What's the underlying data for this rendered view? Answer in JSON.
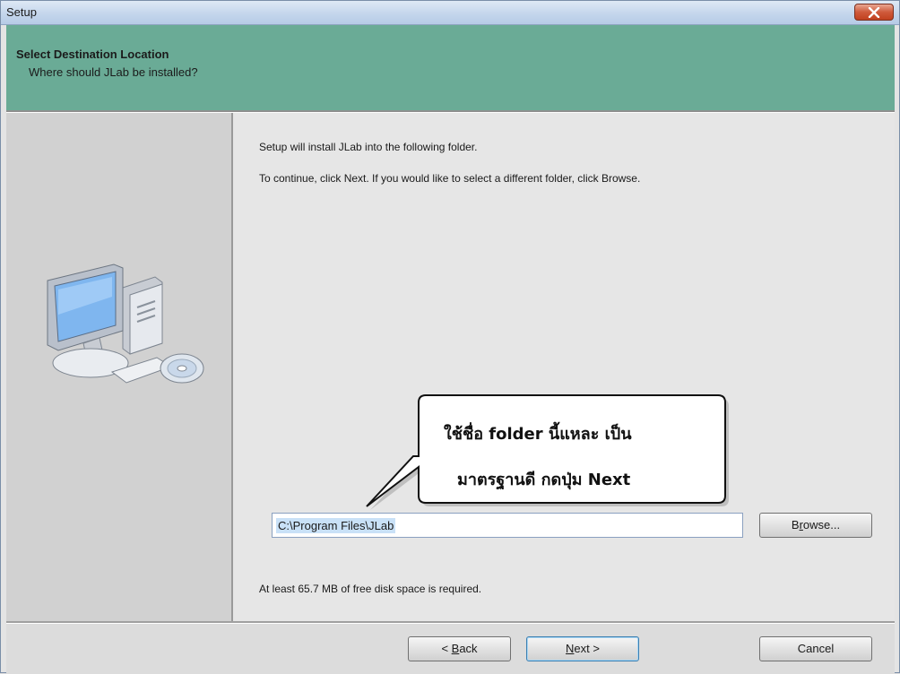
{
  "window": {
    "title": "Setup"
  },
  "header": {
    "title": "Select Destination Location",
    "subtitle": "Where should JLab be installed?"
  },
  "main": {
    "line1": "Setup will install JLab into the following folder.",
    "line2": "To continue, click Next. If you would like to select a different folder, click Browse.",
    "path_value": "C:\\Program Files\\JLab",
    "disk_space": "At least 65.7 MB of free disk space is required."
  },
  "callout": {
    "line1": "ใช้ชื่อ folder นี้แหละ เป็น",
    "line2": "มาตรฐานดี กดปุ่ม Next"
  },
  "buttons": {
    "browse": {
      "pre": "B",
      "accel": "r",
      "post": "owse..."
    },
    "back": {
      "pre": "< ",
      "accel": "B",
      "post": "ack"
    },
    "next": {
      "pre": "",
      "accel": "N",
      "post": "ext >"
    },
    "cancel": "Cancel"
  },
  "colors": {
    "header_bg": "#6aab96",
    "close_button": "#c1411f",
    "selection": "#c9e1f7"
  },
  "icons": [
    "close-icon",
    "computer-illustration"
  ]
}
